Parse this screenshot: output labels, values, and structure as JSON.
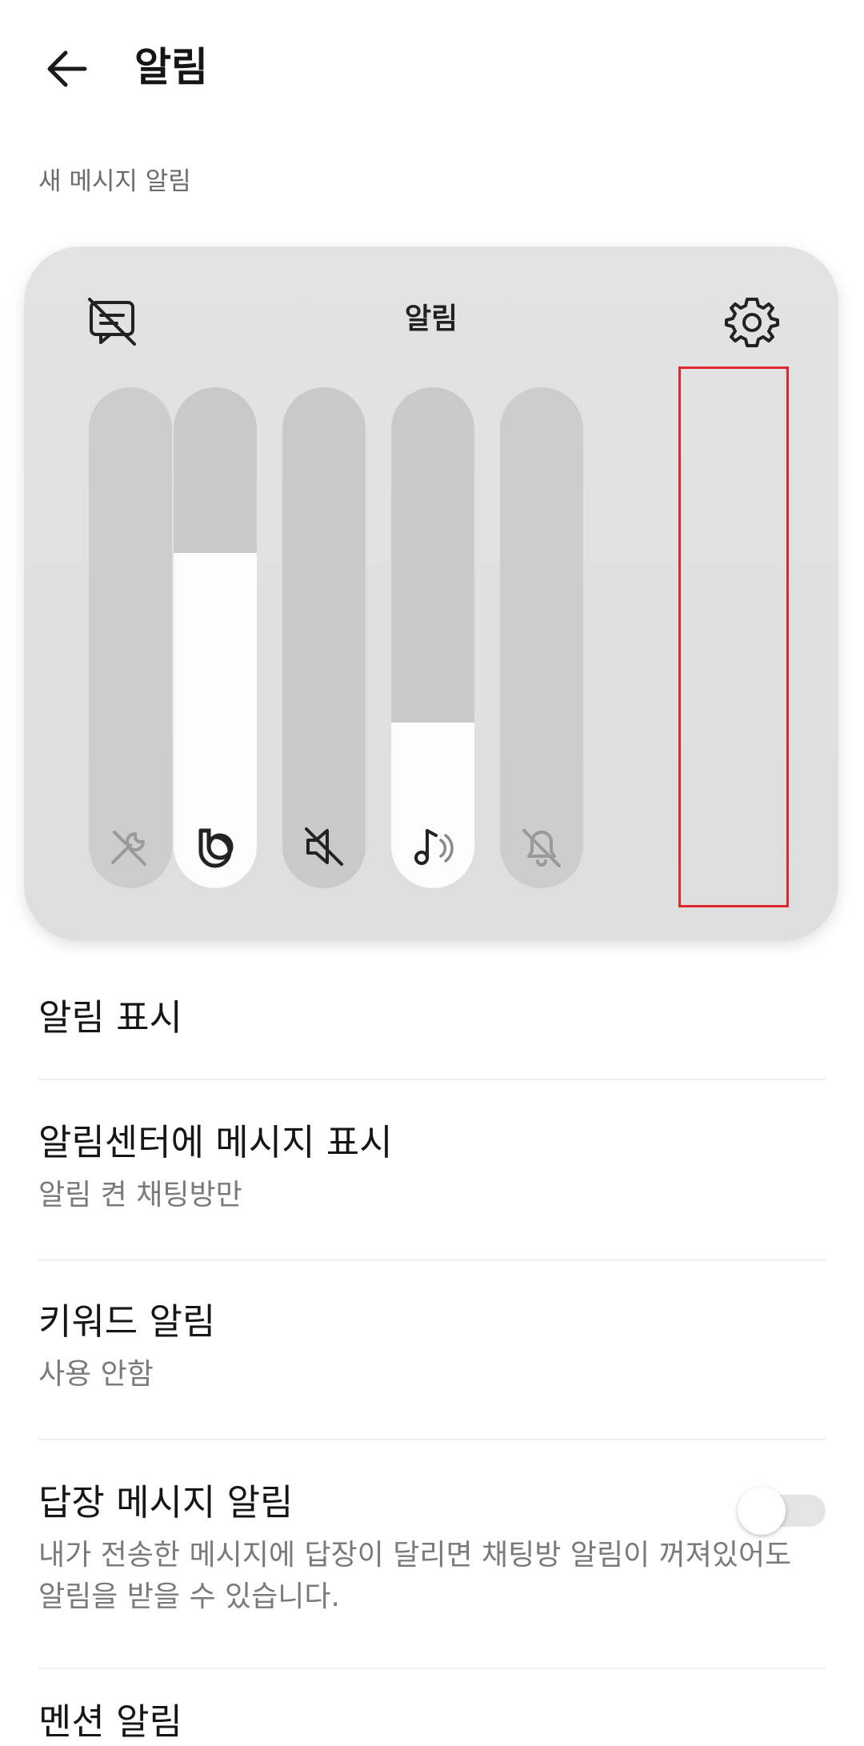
{
  "header": {
    "title": "알림",
    "back_icon": "arrow-left-icon"
  },
  "section_label": "새 메시지 알림",
  "panel": {
    "title": "알림",
    "left_icon": "notification-off-icon",
    "right_icon": "gear-icon",
    "sliders": [
      {
        "name": "tool",
        "icon": "wrench-icon",
        "level": 0,
        "enabled": false
      },
      {
        "name": "bixby",
        "icon": "bixby-icon",
        "level": 0.67,
        "enabled": true
      },
      {
        "name": "mute",
        "icon": "speaker-mute-icon",
        "level": 0,
        "enabled": true
      },
      {
        "name": "media",
        "icon": "music-note-icon",
        "level": 0.33,
        "enabled": true
      },
      {
        "name": "notification",
        "icon": "bell-off-icon",
        "level": 0,
        "enabled": false
      }
    ],
    "highlight_color": "#e0262f"
  },
  "list": {
    "show_notifications": {
      "title": "알림 표시"
    },
    "notification_center": {
      "title": "알림센터에 메시지 표시",
      "subtitle": "알림 켠 채팅방만"
    },
    "keyword": {
      "title": "키워드 알림",
      "subtitle": "사용 안함"
    },
    "reply": {
      "title": "답장 메시지 알림",
      "subtitle": "내가 전송한 메시지에 답장이 달리면 채팅방 알림이 꺼져있어도 알림을 받을 수 있습니다.",
      "toggle_on": false
    },
    "mention": {
      "title": "멘션 알림"
    }
  }
}
